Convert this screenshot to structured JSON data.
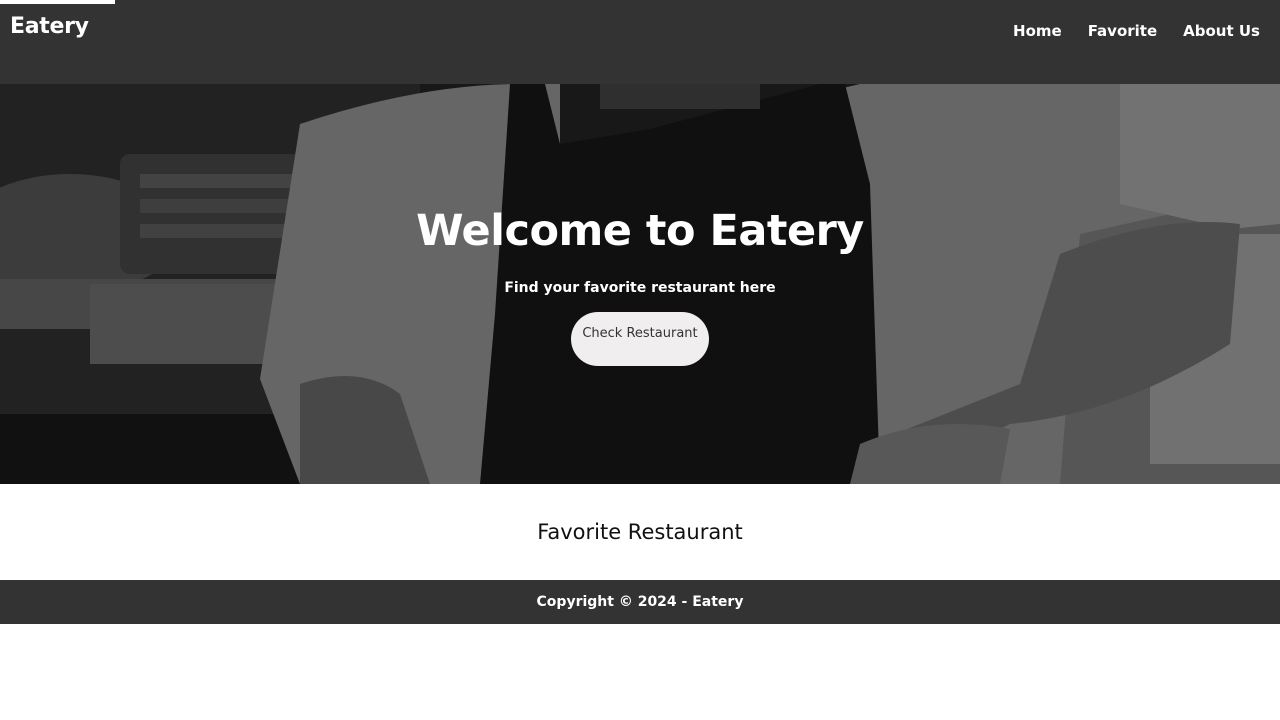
{
  "header": {
    "brand": "Eatery",
    "nav": [
      {
        "label": "Home"
      },
      {
        "label": "Favorite"
      },
      {
        "label": "About Us"
      }
    ]
  },
  "hero": {
    "title": "Welcome to Eatery",
    "subtitle": "Find your favorite restaurant here",
    "button_label": "Check Restaurant"
  },
  "favorites": {
    "heading": "Favorite Restaurant"
  },
  "footer": {
    "copyright": "Copyright © 2024 - Eatery"
  },
  "colors": {
    "header_bg": "#333333",
    "footer_bg": "#333333",
    "button_bg": "#f0eeee"
  }
}
